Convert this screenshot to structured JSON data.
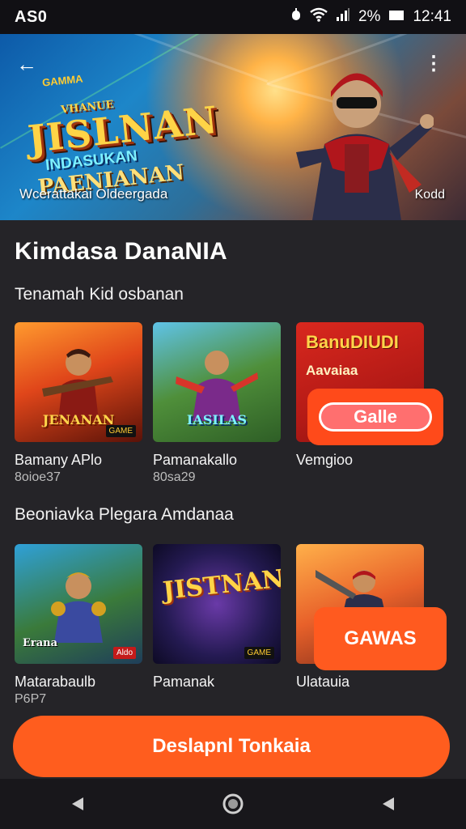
{
  "status": {
    "left": "AS0",
    "battery": "2%",
    "time": "12:41"
  },
  "banner": {
    "logo_small": "GAMMA",
    "logo_line1": "VHANUE",
    "logo_line2": "JISLNAN",
    "logo_line3": "INDASUKAN",
    "logo_line4": "PAENIANAN",
    "caption_left": "Wcerattakai Oldeergada",
    "caption_right": "Kodd"
  },
  "page_title": "Kimdasa DanaNIA",
  "section1": {
    "title": "Tenamah Kid osbanan",
    "cards": [
      {
        "title": "Bamany APlo",
        "sub": "8oioe37",
        "thumb_label": "JENANAN",
        "corner": "GAME"
      },
      {
        "title": "Pamanakallo",
        "sub": "80sa29",
        "thumb_label": "IASILAS"
      },
      {
        "title": "Vemgioo",
        "red_title": "BanuDIUDI",
        "red_sub": "Aavaiaa",
        "pill": "Galle"
      }
    ]
  },
  "section2": {
    "title": "Beoniavka Plegara Amdanaa",
    "cards": [
      {
        "title": "Matarabaulb",
        "sub": "P6P7",
        "thumb_label": "Erana",
        "corner": "Aldo"
      },
      {
        "title": "Pamanak",
        "thumb_label": "JISTNAN",
        "corner": "GAME"
      },
      {
        "title": "Ulatauia"
      }
    ],
    "overlay_button": "GAWAS"
  },
  "cta": "Deslapnl Tonkaia",
  "colors": {
    "accent": "#ff5d1e",
    "background": "#252428",
    "status": "#111014"
  }
}
